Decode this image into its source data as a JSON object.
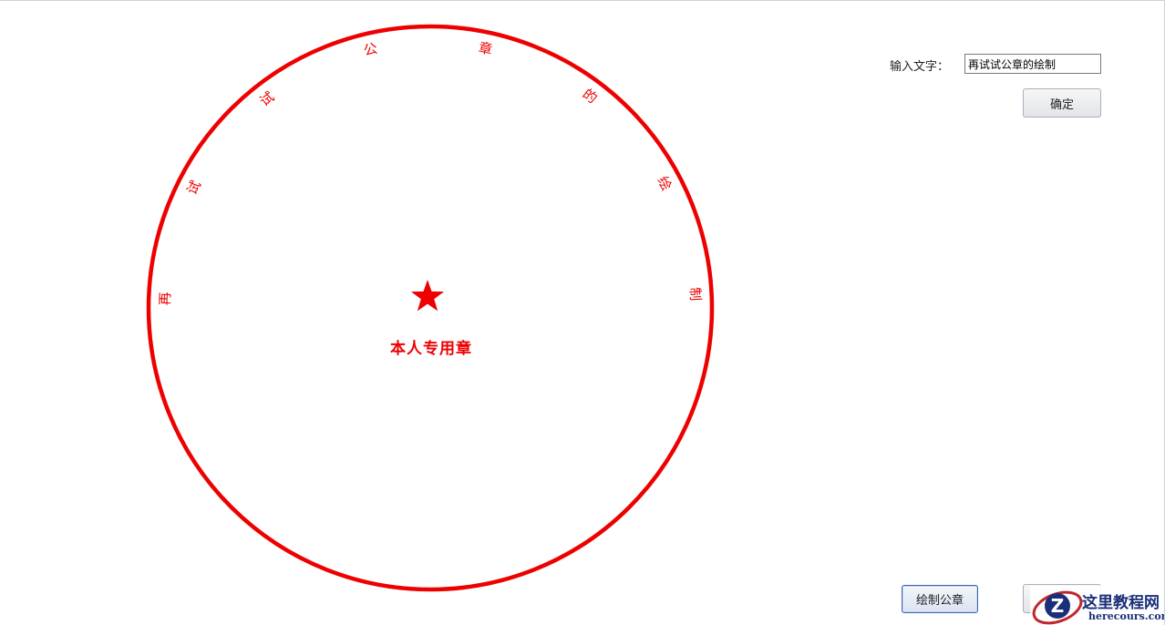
{
  "seal": {
    "ring_text": [
      "再",
      "试",
      "试",
      "公",
      "章",
      "的",
      "绘",
      "制"
    ],
    "center_text": "本人专用章",
    "color": "#ee0000"
  },
  "form": {
    "input_label": "输入文字：",
    "input_value": "再试试公章的绘制",
    "confirm_label": "确定"
  },
  "footer": {
    "draw_button_label": "绘制公章",
    "second_button_label": ""
  },
  "watermark": {
    "text_cn": "这里教程网",
    "text_en": "herecours.com"
  }
}
